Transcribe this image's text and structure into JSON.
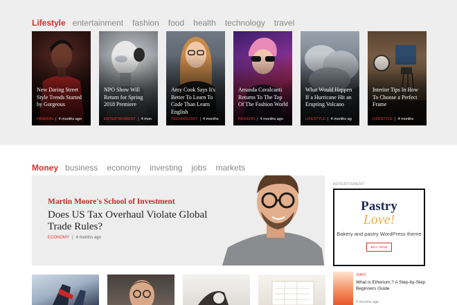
{
  "lifestyle": {
    "active_tab": "Lifestyle",
    "tabs": [
      "entertainment",
      "fashion",
      "food",
      "health",
      "technology",
      "travel"
    ],
    "cards": [
      {
        "title": "New Daring Street Style Trends Started by Gorgeous",
        "category": "FASHION",
        "time": "4 months ago"
      },
      {
        "title": "NPO Show Will Return for Spring 2018 Premiere",
        "category": "ENTERTAINMENT",
        "time": "4 mon"
      },
      {
        "title": "Amy Cook Says It's Better To Learn To Code Than Learn English",
        "category": "TECHNOLOGY",
        "time": "4 months"
      },
      {
        "title": "Amanda Cavalcanti Returns To The Top Of The Fashion World",
        "category": "FASHION",
        "time": "4 months ago"
      },
      {
        "title": "What Would Happen If a Hurricane Hit an Erupting Volcano",
        "category": "LIFESTYLE",
        "time": "4 months ag"
      },
      {
        "title": "Interior Tips In How To Choose a Perfect Frame",
        "category": "LIFESTYLE",
        "time": "4 months"
      }
    ]
  },
  "money": {
    "active_tab": "Money",
    "tabs": [
      "business",
      "economy",
      "investing",
      "jobs",
      "markets"
    ],
    "hero": {
      "kicker": "Martin Moore's School of Investment",
      "headline": "Does US Tax Overhaul Violate Global Trade Rules?",
      "category": "ECONOMY",
      "time": "4 months ago"
    },
    "ad": {
      "label": "ADVERTISMENT",
      "brand_line1": "Pastry",
      "brand_line2": "Love!",
      "tagline": "Bakery and pastry WordPress theme",
      "button": "BUY NOW"
    },
    "side_item": {
      "category": "JOBS",
      "title": "What is Etherium.? A Step-by-Step Beginners Guide",
      "time": "5 months ago"
    }
  },
  "colors": {
    "accent": "#d32f2f",
    "section_bg": "#eeeeef",
    "ad_brand": "#1f2a55",
    "ad_script": "#e8b04a"
  }
}
